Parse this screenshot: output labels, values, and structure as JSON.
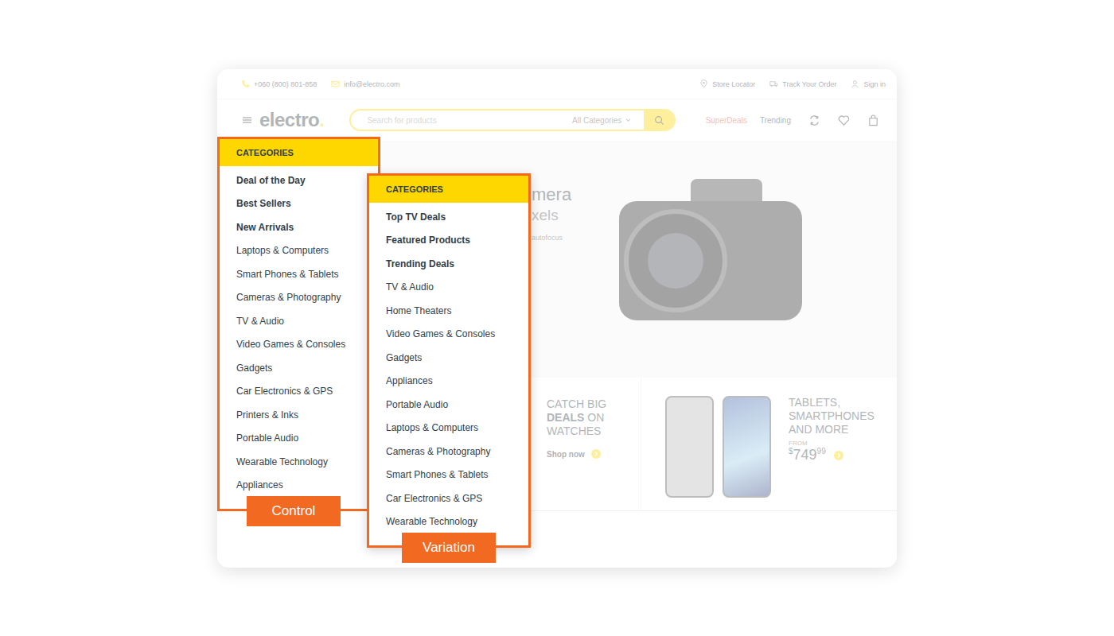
{
  "topbar": {
    "phone": "+060 (800) 801-858",
    "email": "info@electro.com",
    "links": [
      "Store Locator",
      "Track Your Order",
      "Sign in"
    ]
  },
  "header": {
    "logo": {
      "word": "electro",
      "dot": "."
    },
    "search": {
      "placeholder": "Search for products",
      "category": "All Categories"
    },
    "nav": [
      {
        "label": "SuperDeals",
        "color": "#e8574b"
      },
      {
        "label": "Trending",
        "color": "#333e48"
      }
    ]
  },
  "hero": {
    "lines": [
      "mera",
      "xels",
      "autofocus"
    ]
  },
  "banners": [
    {
      "lines": [
        [
          {
            "text": "CATCH BIG",
            "bold": false
          }
        ],
        [
          {
            "text": "DEALS",
            "bold": true
          },
          {
            "text": " ON",
            "bold": false
          }
        ],
        [
          {
            "text": "WATCHES",
            "bold": false
          }
        ]
      ],
      "link": "Shop now"
    },
    {
      "lines": [
        [
          {
            "text": "TABLETS,",
            "bold": false
          }
        ],
        [
          {
            "text": "SMARTPHONES",
            "bold": false
          }
        ],
        [
          {
            "text": "AND MORE",
            "bold": false
          }
        ]
      ],
      "price_label": "FROM",
      "price": {
        "currency": "$",
        "whole": "749",
        "cents": "99"
      }
    }
  ],
  "menus": [
    {
      "label": "Control",
      "title": "CATEGORIES",
      "items": [
        {
          "text": "Deal of the Day",
          "featured": true
        },
        {
          "text": "Best Sellers",
          "featured": true
        },
        {
          "text": "New Arrivals",
          "featured": true
        },
        {
          "text": "Laptops & Computers",
          "featured": false
        },
        {
          "text": "Smart Phones & Tablets",
          "featured": false
        },
        {
          "text": "Cameras & Photography",
          "featured": false
        },
        {
          "text": "TV & Audio",
          "featured": false
        },
        {
          "text": "Video Games & Consoles",
          "featured": false
        },
        {
          "text": "Gadgets",
          "featured": false
        },
        {
          "text": "Car Electronics & GPS",
          "featured": false
        },
        {
          "text": "Printers & Inks",
          "featured": false
        },
        {
          "text": "Portable Audio",
          "featured": false
        },
        {
          "text": "Wearable Technology",
          "featured": false
        },
        {
          "text": "Appliances",
          "featured": false
        }
      ]
    },
    {
      "label": "Variation",
      "title": "CATEGORIES",
      "items": [
        {
          "text": "Top TV Deals",
          "featured": true
        },
        {
          "text": "Featured Products",
          "featured": true
        },
        {
          "text": "Trending Deals",
          "featured": true
        },
        {
          "text": "TV & Audio",
          "featured": false
        },
        {
          "text": "Home Theaters",
          "featured": false
        },
        {
          "text": "Video Games & Consoles",
          "featured": false
        },
        {
          "text": "Gadgets",
          "featured": false
        },
        {
          "text": "Appliances",
          "featured": false
        },
        {
          "text": "Portable Audio",
          "featured": false
        },
        {
          "text": "Laptops & Computers",
          "featured": false
        },
        {
          "text": "Cameras & Photography",
          "featured": false
        },
        {
          "text": "Smart Phones & Tablets",
          "featured": false
        },
        {
          "text": "Car Electronics & GPS",
          "featured": false
        },
        {
          "text": "Wearable Technology",
          "featured": false
        }
      ]
    }
  ]
}
